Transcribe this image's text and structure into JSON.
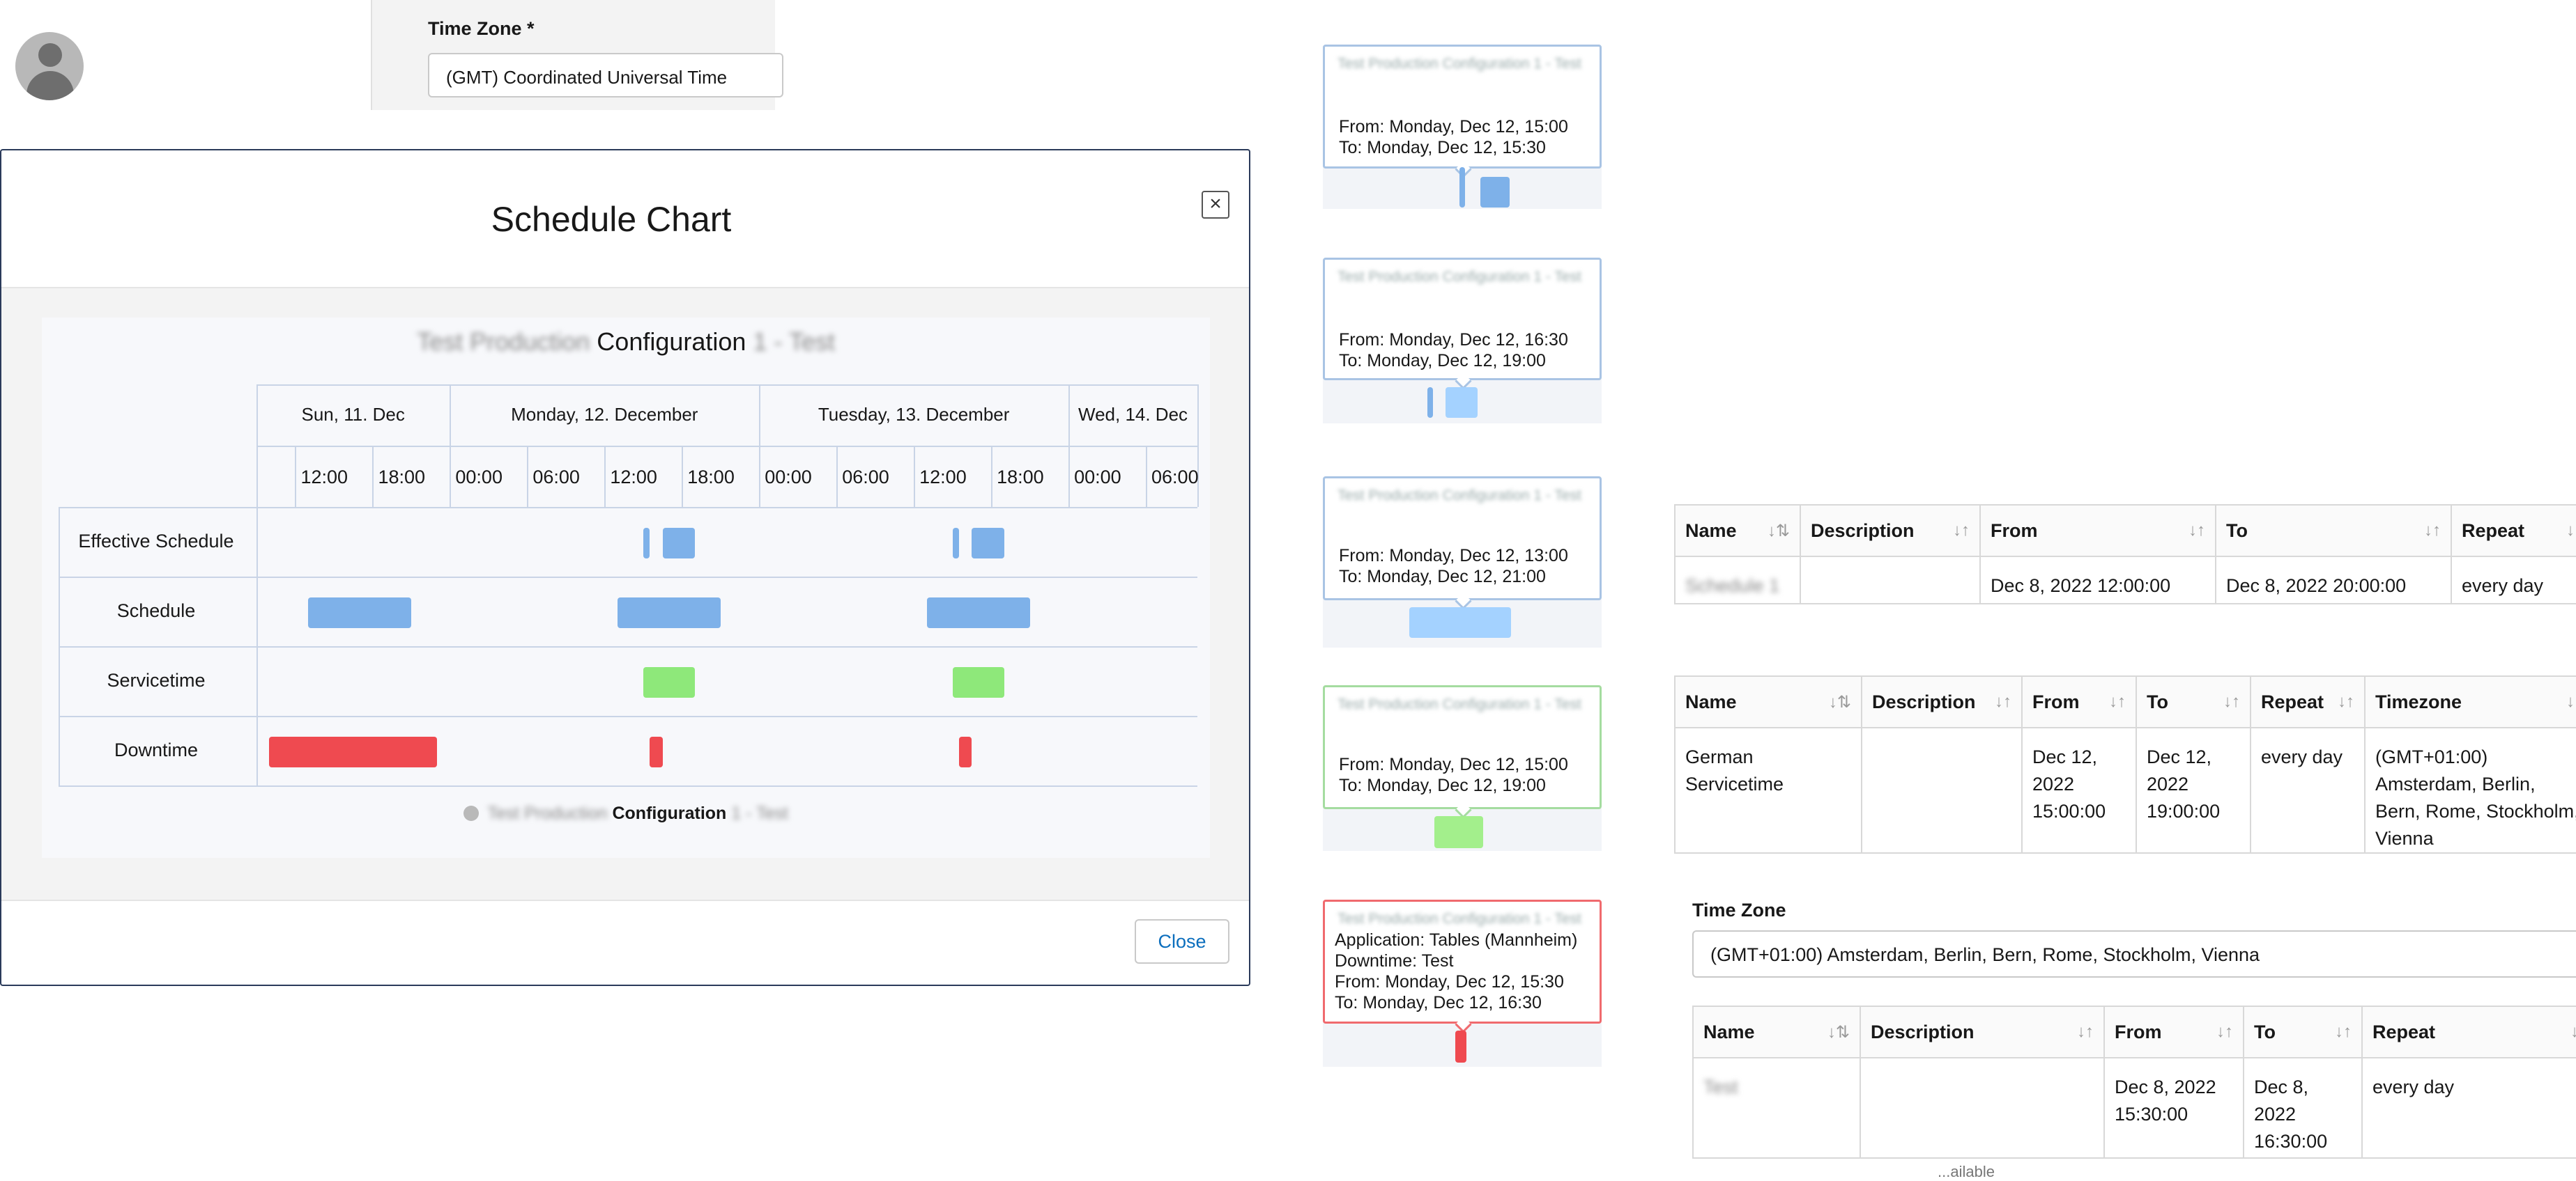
{
  "header": {
    "avatar_icon": "user-avatar-icon",
    "tz_label": "Time Zone *",
    "tz_value": "(GMT) Coordinated Universal Time"
  },
  "modal": {
    "title": "Schedule Chart",
    "close_icon": "close-icon",
    "close_button": "Close",
    "chart_data": {
      "type": "gantt",
      "title_visible": "Configuration",
      "title_blurred_prefix": "Test Production",
      "title_blurred_suffix": "1 - Test",
      "date_headers": [
        "Sun, 11. Dec",
        "Monday, 12. December",
        "Tuesday, 13. December",
        "Wed, 14. Dec"
      ],
      "time_ticks": [
        "12:00",
        "18:00",
        "00:00",
        "06:00",
        "12:00",
        "18:00",
        "00:00",
        "06:00",
        "12:00",
        "18:00",
        "00:00",
        "06:00"
      ],
      "rows": [
        "Effective Schedule",
        "Schedule",
        "Servicetime",
        "Downtime"
      ],
      "colors": {
        "schedule": "#7eb1e9",
        "servicetime": "#8ee87a",
        "downtime": "#ef4a50"
      },
      "bars": [
        {
          "row": "Effective Schedule",
          "from": "Dec 12 15:00",
          "to": "Dec 12 15:30"
        },
        {
          "row": "Effective Schedule",
          "from": "Dec 12 16:30",
          "to": "Dec 12 19:00"
        },
        {
          "row": "Effective Schedule",
          "from": "Dec 13 15:00",
          "to": "Dec 13 15:30"
        },
        {
          "row": "Effective Schedule",
          "from": "Dec 13 16:30",
          "to": "Dec 13 19:00"
        },
        {
          "row": "Schedule",
          "from": "Dec 11 13:00",
          "to": "Dec 11 21:00"
        },
        {
          "row": "Schedule",
          "from": "Dec 12 13:00",
          "to": "Dec 12 21:00"
        },
        {
          "row": "Schedule",
          "from": "Dec 13 13:00",
          "to": "Dec 13 21:00"
        },
        {
          "row": "Servicetime",
          "from": "Dec 12 15:00",
          "to": "Dec 12 19:00"
        },
        {
          "row": "Servicetime",
          "from": "Dec 13 15:00",
          "to": "Dec 13 19:00"
        },
        {
          "row": "Downtime",
          "from": "Dec 11 10:00",
          "to": "Dec 11 23:00"
        },
        {
          "row": "Downtime",
          "from": "Dec 12 15:30",
          "to": "Dec 12 16:30"
        },
        {
          "row": "Downtime",
          "from": "Dec 13 15:30",
          "to": "Dec 13 16:30"
        }
      ],
      "legend_visible": "Configuration",
      "legend_blurred_prefix": "Test Production",
      "legend_blurred_suffix": "1 - Test"
    }
  },
  "tooltips": [
    {
      "blurred": "Test Production Configuration 1 - Test",
      "lines": [
        "From: Monday, Dec 12, 15:00",
        "To: Monday, Dec 12, 15:30"
      ]
    },
    {
      "blurred": "Test Production Configuration 1 - Test",
      "lines": [
        "From: Monday, Dec 12, 16:30",
        "To: Monday, Dec 12, 19:00"
      ]
    },
    {
      "blurred": "Test Production Configuration 1 - Test",
      "lines": [
        "From: Monday, Dec 12, 13:00",
        "To: Monday, Dec 12, 21:00"
      ]
    },
    {
      "blurred": "Test Production Configuration 1 - Test",
      "lines": [
        "From: Monday, Dec 12, 15:00",
        "To: Monday, Dec 12, 19:00"
      ]
    },
    {
      "blurred": "Test Production Configuration 1 - Test",
      "lines": [
        "Application: Tables (Mannheim)",
        " Downtime: Test",
        " From: Monday, Dec 12, 15:30",
        " To: Monday, Dec 12, 16:30"
      ]
    }
  ],
  "table1": {
    "headers": [
      "Name",
      "Description",
      "From",
      "To",
      "Repeat"
    ],
    "row": {
      "name_blurred": "Schedule 1",
      "description": "",
      "from": "Dec 8, 2022 12:00:00",
      "to": "Dec 8, 2022 20:00:00",
      "repeat": "every day"
    }
  },
  "table2": {
    "headers": [
      "Name",
      "Description",
      "From",
      "To",
      "Repeat",
      "Timezone"
    ],
    "row": {
      "name": "German Servicetime",
      "description": "",
      "from": "Dec 12, 2022 15:00:00",
      "to": "Dec 12, 2022 19:00:00",
      "repeat": "every day",
      "timezone": "(GMT+01:00) Amsterdam, Berlin, Bern, Rome, Stockholm, Vienna"
    }
  },
  "timezone2": {
    "label": "Time Zone",
    "value": "(GMT+01:00) Amsterdam, Berlin, Bern, Rome, Stockholm, Vienna"
  },
  "table3": {
    "headers": [
      "Name",
      "Description",
      "From",
      "To",
      "Repeat"
    ],
    "row": {
      "name_blurred": "Test",
      "description": "",
      "from": "Dec 8, 2022 15:30:00",
      "to": "Dec 8, 2022 16:30:00",
      "repeat": "every day"
    },
    "footer_partial": "...ailable"
  },
  "sort_icon": "sort-arrows-icon"
}
